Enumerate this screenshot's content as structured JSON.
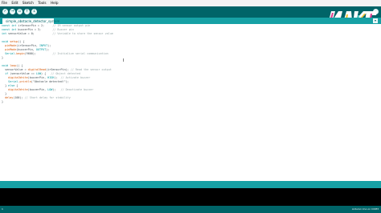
{
  "menubar": {
    "items": [
      "File",
      "Edit",
      "Sketch",
      "Tools",
      "Help"
    ]
  },
  "toolbar": {
    "buttons": [
      {
        "name": "verify-button",
        "icon": "checkmark-icon",
        "glyph": "✓"
      },
      {
        "name": "upload-button",
        "icon": "arrow-right-icon",
        "glyph": "→"
      },
      {
        "name": "new-button",
        "icon": "new-file-icon",
        "glyph": "▫"
      },
      {
        "name": "open-button",
        "icon": "open-arrow-up-icon",
        "glyph": "↑"
      },
      {
        "name": "save-button",
        "icon": "save-arrow-down-icon",
        "glyph": "↓"
      }
    ],
    "serial_monitor_icon": "magnifier-icon"
  },
  "tab": {
    "label": "simple_obstacle_detector_system",
    "menu_glyph": "▾"
  },
  "code": [
    "const int irSensorPin = 2;     // IR sensor output pin",
    "const int buzzerPin = 3;       // Buzzer pin",
    "int sensorValue = 0;           // Variable to store the sensor value",
    "",
    "void setup() {",
    "  pinMode(irSensorPin, INPUT);",
    "  pinMode(buzzerPin, OUTPUT);",
    "  Serial.begin(9600);          // Initialize serial communication",
    "}",
    "",
    "void loop() {",
    "  sensorValue = digitalRead(irSensorPin); // Read the sensor output",
    "  if (sensorValue == LOW) {   // Object detected",
    "    digitalWrite(buzzerPin, HIGH);  // Activate buzzer",
    "    Serial.println(\"Obstacle detected!\");",
    "  } else {",
    "    digitalWrite(buzzerPin, LOW);   // Deactivate buzzer",
    "  }",
    "  delay(100); // Short delay for stability",
    "}"
  ],
  "status": {
    "line": "1",
    "board": "Arduino Uno on COM3"
  },
  "colors": {
    "toolbar": "#006468",
    "tabbar": "#17a1a5",
    "keyword": "#00979d",
    "function": "#d35400",
    "comment": "#95a5a6",
    "console": "#000000"
  }
}
